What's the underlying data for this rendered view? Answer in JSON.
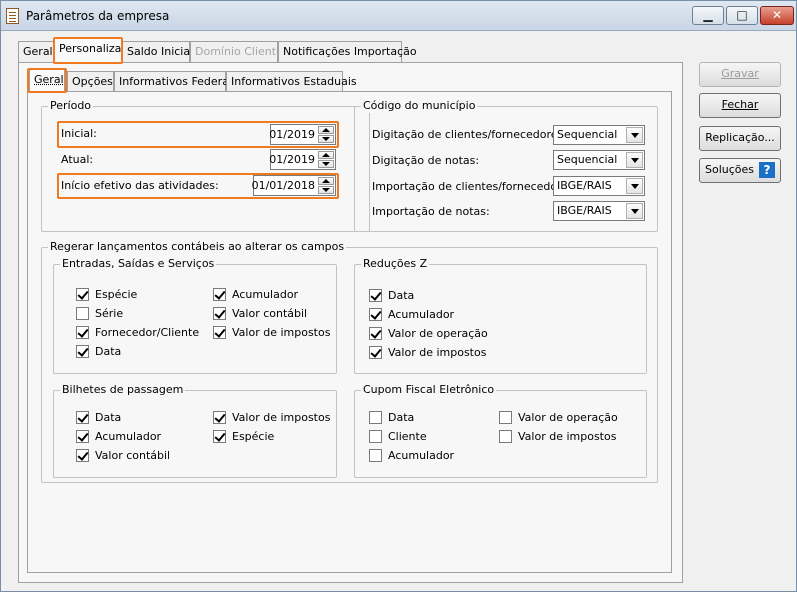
{
  "window": {
    "title": "Parâmetros da empresa",
    "min_glyph": "▁",
    "max_glyph": "□",
    "close_glyph": "✕"
  },
  "top_tabs": [
    {
      "label": "Geral",
      "state": "normal"
    },
    {
      "label": "Personaliza",
      "state": "selected"
    },
    {
      "label": "Saldo Inicial",
      "state": "normal"
    },
    {
      "label": "Domínio Cliente",
      "state": "disabled"
    },
    {
      "label": "Notificações Importação",
      "state": "normal"
    }
  ],
  "sub_tabs": [
    {
      "label": "Geral",
      "state": "selected"
    },
    {
      "label": "Opções",
      "state": "normal"
    },
    {
      "label": "Informativos Federais",
      "state": "normal"
    },
    {
      "label": "Informativos Estaduais",
      "state": "normal"
    }
  ],
  "periodo": {
    "title": "Período",
    "inicial_label": "Inicial:",
    "inicial_value": "01/2019",
    "atual_label": "Atual:",
    "atual_value": "01/2019",
    "inicio_label": "Início efetivo das atividades:",
    "inicio_value": "01/01/2018"
  },
  "municipio": {
    "title": "Código do município",
    "rows": [
      {
        "label": "Digitação de clientes/fornecedores:",
        "value": "Sequencial"
      },
      {
        "label": "Digitação de notas:",
        "value": "Sequencial"
      },
      {
        "label": "Importação de clientes/fornecedores:",
        "value": "IBGE/RAIS"
      },
      {
        "label": "Importação de notas:",
        "value": "IBGE/RAIS"
      }
    ]
  },
  "regerar": {
    "title": "Regerar lançamentos contábeis ao alterar os campos",
    "entradas": {
      "title": "Entradas, Saídas e Serviços",
      "items": [
        {
          "label": "Espécie",
          "checked": true
        },
        {
          "label": "Série",
          "checked": false
        },
        {
          "label": "Fornecedor/Cliente",
          "checked": true
        },
        {
          "label": "Data",
          "checked": true
        },
        {
          "label": "Acumulador",
          "checked": true
        },
        {
          "label": "Valor contábil",
          "checked": true
        },
        {
          "label": "Valor de impostos",
          "checked": true
        }
      ]
    },
    "reducoes": {
      "title": "Reduções Z",
      "items": [
        {
          "label": "Data",
          "checked": true
        },
        {
          "label": "Acumulador",
          "checked": true
        },
        {
          "label": "Valor de operação",
          "checked": true
        },
        {
          "label": "Valor de impostos",
          "checked": true
        }
      ]
    },
    "bilhetes": {
      "title": "Bilhetes de passagem",
      "items": [
        {
          "label": "Data",
          "checked": true
        },
        {
          "label": "Acumulador",
          "checked": true
        },
        {
          "label": "Valor contábil",
          "checked": true
        },
        {
          "label": "Valor de impostos",
          "checked": true
        },
        {
          "label": "Espécie",
          "checked": true
        }
      ]
    },
    "cupom": {
      "title": "Cupom Fiscal Eletrônico",
      "items": [
        {
          "label": "Data",
          "checked": false
        },
        {
          "label": "Cliente",
          "checked": false
        },
        {
          "label": "Acumulador",
          "checked": false
        },
        {
          "label": "Valor de operação",
          "checked": false
        },
        {
          "label": "Valor de impostos",
          "checked": false
        }
      ]
    }
  },
  "buttons": {
    "gravar": "Gravar",
    "fechar": "Fechar",
    "replicacao": "Replicação...",
    "solucoes": "Soluções",
    "help_glyph": "?"
  },
  "colors": {
    "highlight": "#f07a22",
    "help_icon": "#1b6fc4"
  }
}
